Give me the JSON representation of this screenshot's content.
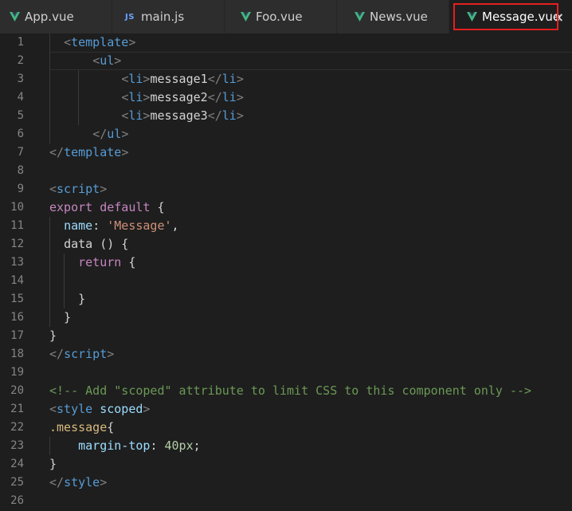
{
  "tabs": [
    {
      "label": "App.vue",
      "icon": "vue-icon",
      "active": false
    },
    {
      "label": "main.js",
      "icon": "js-icon",
      "icon_text": "JS",
      "active": false
    },
    {
      "label": "Foo.vue",
      "icon": "vue-icon",
      "active": false
    },
    {
      "label": "News.vue",
      "icon": "vue-icon",
      "active": false
    },
    {
      "label": "Message.vue",
      "icon": "vue-icon",
      "active": true,
      "close_glyph": "×"
    }
  ],
  "colors": {
    "vue_green": "#41b883",
    "highlight_border": "#e51f1f",
    "background": "#1e1e1e"
  },
  "code_lines": [
    {
      "n": "1",
      "parts": [
        [
          "t-bracket",
          "<"
        ],
        [
          "t-tag",
          "template"
        ],
        [
          "t-bracket",
          ">"
        ]
      ],
      "indent": "  "
    },
    {
      "n": "2",
      "parts": [
        [
          "t-bracket",
          "<"
        ],
        [
          "t-tag",
          "ul"
        ],
        [
          "t-bracket",
          ">"
        ]
      ],
      "indent": "      "
    },
    {
      "n": "3",
      "parts": [
        [
          "t-bracket",
          "<"
        ],
        [
          "t-tag",
          "li"
        ],
        [
          "t-bracket",
          ">"
        ],
        [
          "t-text",
          "message1"
        ],
        [
          "t-bracket",
          "</"
        ],
        [
          "t-tag",
          "li"
        ],
        [
          "t-bracket",
          ">"
        ]
      ],
      "indent": "          "
    },
    {
      "n": "4",
      "parts": [
        [
          "t-bracket",
          "<"
        ],
        [
          "t-tag",
          "li"
        ],
        [
          "t-bracket",
          ">"
        ],
        [
          "t-text",
          "message2"
        ],
        [
          "t-bracket",
          "</"
        ],
        [
          "t-tag",
          "li"
        ],
        [
          "t-bracket",
          ">"
        ]
      ],
      "indent": "          "
    },
    {
      "n": "5",
      "parts": [
        [
          "t-bracket",
          "<"
        ],
        [
          "t-tag",
          "li"
        ],
        [
          "t-bracket",
          ">"
        ],
        [
          "t-text",
          "message3"
        ],
        [
          "t-bracket",
          "</"
        ],
        [
          "t-tag",
          "li"
        ],
        [
          "t-bracket",
          ">"
        ]
      ],
      "indent": "          "
    },
    {
      "n": "6",
      "parts": [
        [
          "t-bracket",
          "</"
        ],
        [
          "t-tag",
          "ul"
        ],
        [
          "t-bracket",
          ">"
        ]
      ],
      "indent": "      "
    },
    {
      "n": "7",
      "parts": [
        [
          "t-bracket",
          "</"
        ],
        [
          "t-tag",
          "template"
        ],
        [
          "t-bracket",
          ">"
        ]
      ],
      "indent": ""
    },
    {
      "n": "8",
      "parts": [],
      "indent": ""
    },
    {
      "n": "9",
      "parts": [
        [
          "t-bracket",
          "<"
        ],
        [
          "t-tag",
          "script"
        ],
        [
          "t-bracket",
          ">"
        ]
      ],
      "indent": ""
    },
    {
      "n": "10",
      "parts": [
        [
          "t-kw",
          "export"
        ],
        [
          "t-text",
          " "
        ],
        [
          "t-kw",
          "default"
        ],
        [
          "t-text",
          " {"
        ]
      ],
      "indent": ""
    },
    {
      "n": "11",
      "parts": [
        [
          "t-prop",
          "name"
        ],
        [
          "t-text",
          ": "
        ],
        [
          "t-str",
          "'Message'"
        ],
        [
          "t-text",
          ","
        ]
      ],
      "indent": "  "
    },
    {
      "n": "12",
      "parts": [
        [
          "t-text",
          "data () {"
        ]
      ],
      "indent": "  "
    },
    {
      "n": "13",
      "parts": [
        [
          "t-kw",
          "return"
        ],
        [
          "t-text",
          " {"
        ]
      ],
      "indent": "    "
    },
    {
      "n": "14",
      "parts": [],
      "indent": ""
    },
    {
      "n": "15",
      "parts": [
        [
          "t-text",
          "}"
        ]
      ],
      "indent": "    "
    },
    {
      "n": "16",
      "parts": [
        [
          "t-text",
          "}"
        ]
      ],
      "indent": "  "
    },
    {
      "n": "17",
      "parts": [
        [
          "t-text",
          "}"
        ]
      ],
      "indent": ""
    },
    {
      "n": "18",
      "parts": [
        [
          "t-bracket",
          "</"
        ],
        [
          "t-tag",
          "script"
        ],
        [
          "t-bracket",
          ">"
        ]
      ],
      "indent": ""
    },
    {
      "n": "19",
      "parts": [],
      "indent": ""
    },
    {
      "n": "20",
      "parts": [
        [
          "t-cmt",
          "<!-- Add \"scoped\" attribute to limit CSS to this component only -->"
        ]
      ],
      "indent": ""
    },
    {
      "n": "21",
      "parts": [
        [
          "t-bracket",
          "<"
        ],
        [
          "t-tag",
          "style"
        ],
        [
          "t-text",
          " "
        ],
        [
          "t-attr",
          "scoped"
        ],
        [
          "t-bracket",
          ">"
        ]
      ],
      "indent": ""
    },
    {
      "n": "22",
      "parts": [
        [
          "t-sel",
          ".message"
        ],
        [
          "t-text",
          "{"
        ]
      ],
      "indent": ""
    },
    {
      "n": "23",
      "parts": [
        [
          "t-prop",
          "margin-top"
        ],
        [
          "t-text",
          ": "
        ],
        [
          "t-num",
          "40px"
        ],
        [
          "t-text",
          ";"
        ]
      ],
      "indent": "    "
    },
    {
      "n": "24",
      "parts": [
        [
          "t-text",
          "}"
        ]
      ],
      "indent": ""
    },
    {
      "n": "25",
      "parts": [
        [
          "t-bracket",
          "</"
        ],
        [
          "t-tag",
          "style"
        ],
        [
          "t-bracket",
          ">"
        ]
      ],
      "indent": ""
    },
    {
      "n": "26",
      "parts": [],
      "indent": ""
    }
  ]
}
